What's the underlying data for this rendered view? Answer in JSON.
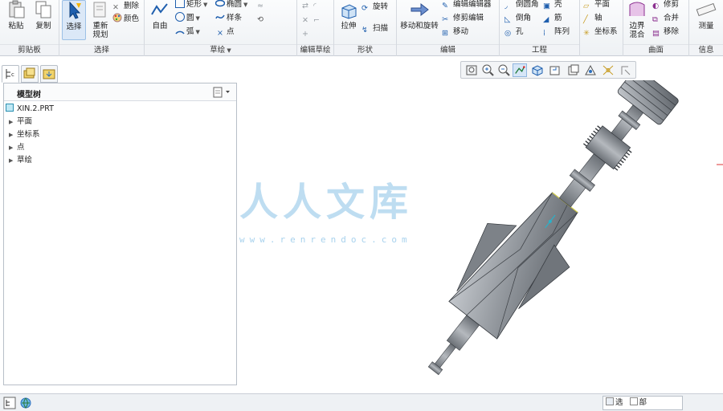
{
  "ribbon": {
    "groups": {
      "clipboard": "剪贴板",
      "operations": "选择",
      "sketch": "草绘",
      "edit_sketch": "编辑草绘",
      "shape": "形状",
      "editing": "编辑",
      "engineering": "工程",
      "surface": "曲面",
      "info": "信息"
    },
    "clipboard": {
      "paste": "粘贴",
      "copy": "复制"
    },
    "operations": {
      "select": "选择",
      "regenerate": "重新\n规划",
      "delete": "删除",
      "color": "颜色"
    },
    "sketch": {
      "free": "自由",
      "rect": "矩形",
      "circle": "圆",
      "arc": "弧",
      "ellipse": "椭圆",
      "spline": "样条",
      "point": "点"
    },
    "edit_sketch": {},
    "shape": {
      "extrude": "拉伸",
      "revolve": "旋转",
      "sweep": "扫描"
    },
    "editing": {
      "transform": "移动和旋转",
      "edit_def": "编辑编辑器",
      "trim": "修剪编辑",
      "move": "移动"
    },
    "engineering": {
      "round": "倒圆角",
      "chamfer": "倒角",
      "hole": "孔",
      "shell": "壳",
      "rib": "筋",
      "array": "阵列"
    },
    "surface": {
      "plane": "平面",
      "axis": "轴",
      "coord": "坐标系",
      "boundary": "边界\n混合",
      "trim": "修剪",
      "merge": "合并",
      "thicken": "移除"
    },
    "info": {
      "measure": "测量"
    }
  },
  "model_tree": {
    "title": "模型树",
    "root": "XIN.2.PRT",
    "items": [
      "平面",
      "坐标系",
      "点",
      "草绘"
    ]
  },
  "watermark": {
    "text": "人人文库",
    "url": "www.renrendoc.com"
  },
  "status_bar": {
    "filter": [
      "选",
      "部"
    ]
  },
  "colors": {
    "accent": "#2a6ebd",
    "model": "#8a8f95",
    "watermark": "#6eb4e1"
  }
}
